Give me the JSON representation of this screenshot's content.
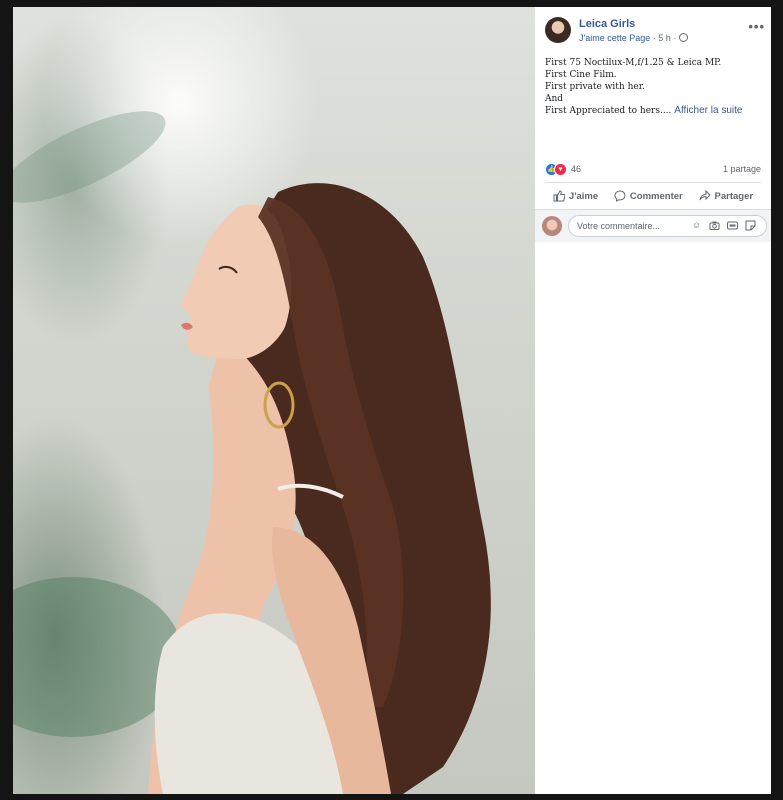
{
  "post": {
    "page_name": "Leica Girls",
    "like_page_label": "J'aime cette Page",
    "separator": "·",
    "time": "5 h",
    "caption_lines": [
      "First 75 Noctilux-M,f/1.25 & Leica MP.",
      "First Cine Film.",
      "First private with her.",
      "And",
      "First Appreciated to hers...."
    ],
    "see_more": "Afficher la suite"
  },
  "reactions": {
    "count": "46",
    "shares": "1 partage"
  },
  "actions": {
    "like": "J'aime",
    "comment": "Commenter",
    "share": "Partager"
  },
  "composer": {
    "placeholder": "Votre commentaire..."
  },
  "icons": {
    "photo": "portrait-photo",
    "more": "more-options-icon",
    "like_reaction": "like-reaction-icon",
    "love_reaction": "love-reaction-icon"
  },
  "colors": {
    "link": "#385898",
    "like_blue": "#1877f2",
    "love_red": "#f02849",
    "text": "#1c1e21",
    "muted": "#606770"
  }
}
